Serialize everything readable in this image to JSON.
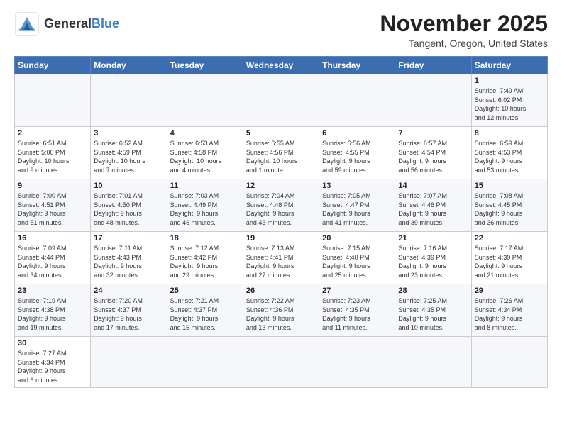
{
  "logo": {
    "text_general": "General",
    "text_blue": "Blue"
  },
  "title": "November 2025",
  "subtitle": "Tangent, Oregon, United States",
  "days_of_week": [
    "Sunday",
    "Monday",
    "Tuesday",
    "Wednesday",
    "Thursday",
    "Friday",
    "Saturday"
  ],
  "weeks": [
    [
      {
        "day": "",
        "info": ""
      },
      {
        "day": "",
        "info": ""
      },
      {
        "day": "",
        "info": ""
      },
      {
        "day": "",
        "info": ""
      },
      {
        "day": "",
        "info": ""
      },
      {
        "day": "",
        "info": ""
      },
      {
        "day": "1",
        "info": "Sunrise: 7:49 AM\nSunset: 6:02 PM\nDaylight: 10 hours\nand 12 minutes."
      }
    ],
    [
      {
        "day": "2",
        "info": "Sunrise: 6:51 AM\nSunset: 5:00 PM\nDaylight: 10 hours\nand 9 minutes."
      },
      {
        "day": "3",
        "info": "Sunrise: 6:52 AM\nSunset: 4:59 PM\nDaylight: 10 hours\nand 7 minutes."
      },
      {
        "day": "4",
        "info": "Sunrise: 6:53 AM\nSunset: 4:58 PM\nDaylight: 10 hours\nand 4 minutes."
      },
      {
        "day": "5",
        "info": "Sunrise: 6:55 AM\nSunset: 4:56 PM\nDaylight: 10 hours\nand 1 minute."
      },
      {
        "day": "6",
        "info": "Sunrise: 6:56 AM\nSunset: 4:55 PM\nDaylight: 9 hours\nand 59 minutes."
      },
      {
        "day": "7",
        "info": "Sunrise: 6:57 AM\nSunset: 4:54 PM\nDaylight: 9 hours\nand 56 minutes."
      },
      {
        "day": "8",
        "info": "Sunrise: 6:59 AM\nSunset: 4:53 PM\nDaylight: 9 hours\nand 53 minutes."
      }
    ],
    [
      {
        "day": "9",
        "info": "Sunrise: 7:00 AM\nSunset: 4:51 PM\nDaylight: 9 hours\nand 51 minutes."
      },
      {
        "day": "10",
        "info": "Sunrise: 7:01 AM\nSunset: 4:50 PM\nDaylight: 9 hours\nand 48 minutes."
      },
      {
        "day": "11",
        "info": "Sunrise: 7:03 AM\nSunset: 4:49 PM\nDaylight: 9 hours\nand 46 minutes."
      },
      {
        "day": "12",
        "info": "Sunrise: 7:04 AM\nSunset: 4:48 PM\nDaylight: 9 hours\nand 43 minutes."
      },
      {
        "day": "13",
        "info": "Sunrise: 7:05 AM\nSunset: 4:47 PM\nDaylight: 9 hours\nand 41 minutes."
      },
      {
        "day": "14",
        "info": "Sunrise: 7:07 AM\nSunset: 4:46 PM\nDaylight: 9 hours\nand 39 minutes."
      },
      {
        "day": "15",
        "info": "Sunrise: 7:08 AM\nSunset: 4:45 PM\nDaylight: 9 hours\nand 36 minutes."
      }
    ],
    [
      {
        "day": "16",
        "info": "Sunrise: 7:09 AM\nSunset: 4:44 PM\nDaylight: 9 hours\nand 34 minutes."
      },
      {
        "day": "17",
        "info": "Sunrise: 7:11 AM\nSunset: 4:43 PM\nDaylight: 9 hours\nand 32 minutes."
      },
      {
        "day": "18",
        "info": "Sunrise: 7:12 AM\nSunset: 4:42 PM\nDaylight: 9 hours\nand 29 minutes."
      },
      {
        "day": "19",
        "info": "Sunrise: 7:13 AM\nSunset: 4:41 PM\nDaylight: 9 hours\nand 27 minutes."
      },
      {
        "day": "20",
        "info": "Sunrise: 7:15 AM\nSunset: 4:40 PM\nDaylight: 9 hours\nand 25 minutes."
      },
      {
        "day": "21",
        "info": "Sunrise: 7:16 AM\nSunset: 4:39 PM\nDaylight: 9 hours\nand 23 minutes."
      },
      {
        "day": "22",
        "info": "Sunrise: 7:17 AM\nSunset: 4:39 PM\nDaylight: 9 hours\nand 21 minutes."
      }
    ],
    [
      {
        "day": "23",
        "info": "Sunrise: 7:19 AM\nSunset: 4:38 PM\nDaylight: 9 hours\nand 19 minutes."
      },
      {
        "day": "24",
        "info": "Sunrise: 7:20 AM\nSunset: 4:37 PM\nDaylight: 9 hours\nand 17 minutes."
      },
      {
        "day": "25",
        "info": "Sunrise: 7:21 AM\nSunset: 4:37 PM\nDaylight: 9 hours\nand 15 minutes."
      },
      {
        "day": "26",
        "info": "Sunrise: 7:22 AM\nSunset: 4:36 PM\nDaylight: 9 hours\nand 13 minutes."
      },
      {
        "day": "27",
        "info": "Sunrise: 7:23 AM\nSunset: 4:35 PM\nDaylight: 9 hours\nand 11 minutes."
      },
      {
        "day": "28",
        "info": "Sunrise: 7:25 AM\nSunset: 4:35 PM\nDaylight: 9 hours\nand 10 minutes."
      },
      {
        "day": "29",
        "info": "Sunrise: 7:26 AM\nSunset: 4:34 PM\nDaylight: 9 hours\nand 8 minutes."
      }
    ],
    [
      {
        "day": "30",
        "info": "Sunrise: 7:27 AM\nSunset: 4:34 PM\nDaylight: 9 hours\nand 6 minutes."
      },
      {
        "day": "",
        "info": ""
      },
      {
        "day": "",
        "info": ""
      },
      {
        "day": "",
        "info": ""
      },
      {
        "day": "",
        "info": ""
      },
      {
        "day": "",
        "info": ""
      },
      {
        "day": "",
        "info": ""
      }
    ]
  ]
}
